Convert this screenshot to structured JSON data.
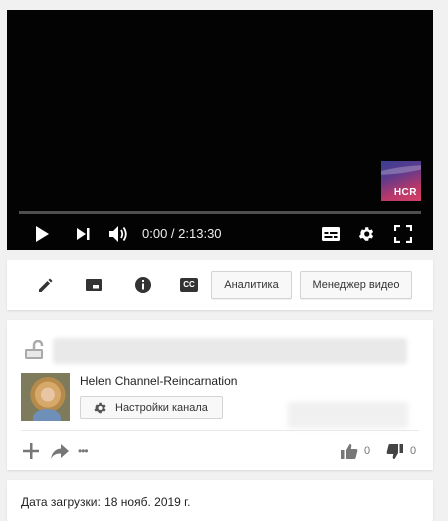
{
  "player": {
    "logo_text": "HCR",
    "time_current": "0:00",
    "time_separator": " / ",
    "time_total": "2:13:30",
    "progress_fraction": 0.0
  },
  "toolbar": {
    "analytics_label": "Аналитика",
    "video_manager_label": "Менеджер видео",
    "cc_badge": "CC"
  },
  "channel": {
    "name": "Helen Channel-Reincarnation",
    "settings_label": "Настройки канала"
  },
  "actions": {
    "like_count": "0",
    "dislike_count": "0",
    "more_dots": "•••"
  },
  "meta": {
    "upload_date": "Дата загрузки: 18 нояб. 2019 г."
  },
  "colors": {
    "player_bg": "#030303",
    "progress_played": "#ff0000",
    "page_bg": "#f1f1f1"
  }
}
